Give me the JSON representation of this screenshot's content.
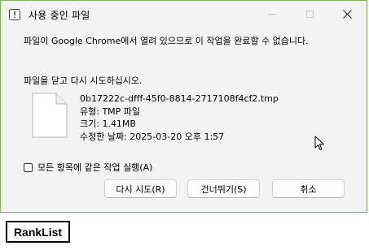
{
  "dialog": {
    "title": "사용 중인 파일",
    "message": "파일이 Google Chrome에서 열려 있으므로 이 작업을 완료할 수 없습니다.",
    "instruction": "파일을 닫고 다시 시도하십시오.",
    "file": {
      "name": "0b17222c-dfff-45f0-8814-2717108f4cf2.tmp",
      "type": "유형: TMP 파일",
      "size": "크기: 1.41MB",
      "modified": "수정한 날짜: 2025-03-20 오후 1:57"
    },
    "apply_all_label": "모든 항목에 같은 작업 실행(A)",
    "apply_all_checked": false,
    "buttons": {
      "retry": "다시 시도(R)",
      "skip": "건너뛰기(S)",
      "cancel": "취소"
    }
  },
  "taskbar": {
    "ranklist_label": "RankList"
  },
  "colors": {
    "dialog_border": "#7fb05a",
    "dialog_bg": "#f3f3f3"
  }
}
